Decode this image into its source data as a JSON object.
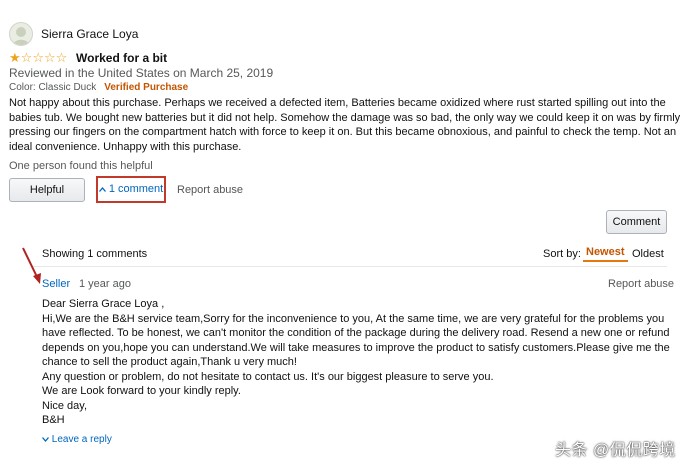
{
  "review": {
    "reviewer_name": "Sierra Grace Loya",
    "rating": 1,
    "max_rating": 5,
    "title": "Worked for a bit",
    "date_line": "Reviewed in the United States on March 25, 2019",
    "color_line": "Color: Classic Duck",
    "verified_label": "Verified Purchase",
    "body": "Not happy about this purchase. Perhaps we received a defected item, Batteries became oxidized where rust started spilling out into the babies tub. We bought new batteries but it did not help. Somehow the damage was so bad, the only way we could keep it on was by firmly pressing our fingers on the compartment hatch with force to keep it on. But this became obnoxious, and painful to check the temp. Not an ideal convenience. Unhappy with this purchase.",
    "helpful_count_text": "One person found this helpful",
    "helpful_button": "Helpful",
    "comment_toggle": "1 comment",
    "report_abuse": "Report abuse"
  },
  "comments": {
    "comment_button": "Comment",
    "showing_text": "Showing 1 comments",
    "sort_label": "Sort by:",
    "sort_options": [
      "Newest",
      "Oldest"
    ],
    "sort_selected": "Newest",
    "items": [
      {
        "author": "Seller",
        "time": "1 year ago",
        "report_abuse": "Report abuse",
        "lines": [
          "Dear Sierra Grace Loya ,",
          "Hi,We are the B&H service team,Sorry for the inconvenience to you, At the same time, we are very grateful for the problems you have reflected. To be honest, we can't monitor the condition of the package during the delivery road. Resend a new one or refund depends on you,hope you can understand.We will take measures to improve the product to satisfy customers.Please give me the chance to sell the product again,Thank u very much!",
          "Any question or problem, do not hesitate to contact us. It's our biggest pleasure to serve you.",
          "We are Look forward to your kindly reply.",
          "Nice day,",
          "B&H"
        ],
        "reply_label": "Leave a reply"
      }
    ]
  },
  "watermark": "头条 @侃侃跨境",
  "colors": {
    "star": "#f0a21a",
    "link": "#0066c0",
    "verified": "#c45500",
    "highlight_box": "#c0392b",
    "arrow": "#b22222"
  },
  "icons": {
    "avatar": "avatar-icon",
    "star": "star-icon",
    "chevron_up": "chevron-up-icon",
    "chevron_down": "chevron-down-icon",
    "arrow": "annotation-arrow-icon"
  }
}
